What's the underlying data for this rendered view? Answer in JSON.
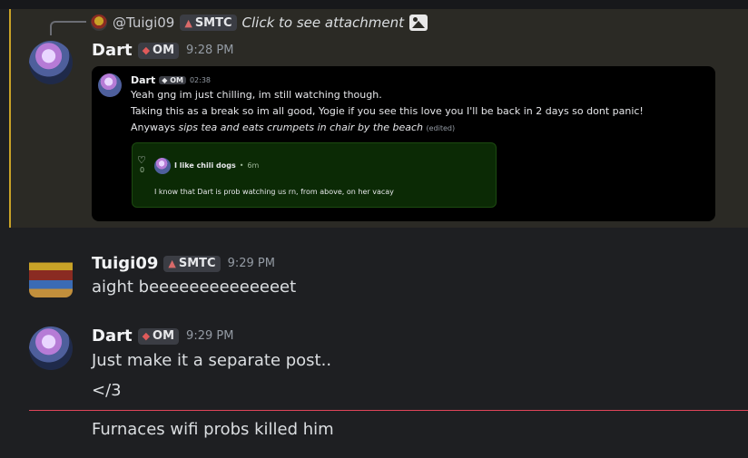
{
  "reply": {
    "mention": "@Tuigi09",
    "tag": "SMTC",
    "attachment_text": "Click to see attachment"
  },
  "messages": [
    {
      "author": "Dart",
      "tag": "OM",
      "time": "9:28 PM",
      "embed": {
        "author": "Dart",
        "tag": "OM",
        "time": "02:38",
        "lines": [
          "Yeah gng im just chilling, im still watching though.",
          "Taking this as a break so im all good, Yogie if you see this love you I'll be back in 2 days so dont panic!",
          "Anyways "
        ],
        "italic": "sips tea and eats crumpets in chair by the beach",
        "edited": "(edited)",
        "post": {
          "likes": "0",
          "title": "I like chili dogs",
          "sep": "•",
          "ago": "6m",
          "text": "I know that Dart is prob watching us rn, from above, on her vacay"
        }
      }
    },
    {
      "author": "Tuigi09",
      "tag": "SMTC",
      "time": "9:29 PM",
      "text": "aight beeeeeeeeeeeeeet"
    },
    {
      "author": "Dart",
      "tag": "OM",
      "time": "9:29 PM",
      "lines": [
        "Just make it a separate post..",
        "</3"
      ]
    }
  ],
  "after_divider": "Furnaces wifi probs killed him",
  "icons": {
    "om": "gem-icon",
    "smtc": "mushroom-icon",
    "image": "image-icon",
    "heart": "heart-icon"
  },
  "colors": {
    "background": "#1e1f22",
    "mention_bg": "#2b2a25",
    "mention_bar": "#c9a227",
    "new_divider": "#e0445a",
    "post_bg": "#0b2a05"
  }
}
